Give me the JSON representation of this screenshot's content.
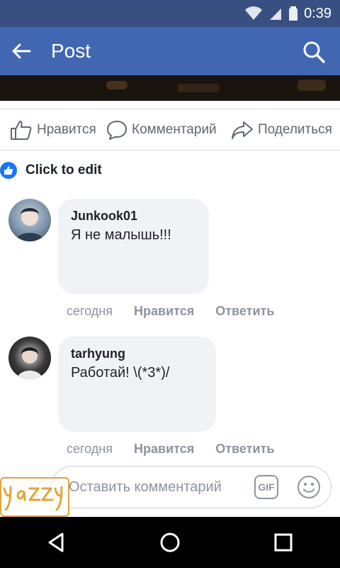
{
  "status_bar": {
    "time": "0:39"
  },
  "app_bar": {
    "title": "Post"
  },
  "actions": {
    "like_label": "Нравится",
    "comment_label": "Комментарий",
    "share_label": "Поделиться"
  },
  "reactions": {
    "label": "Click to edit"
  },
  "comments": [
    {
      "author": "Junkook01",
      "text": "Я не малышь!!!",
      "time": "сегодня",
      "like": "Нравится",
      "reply": "Ответить"
    },
    {
      "author": "tarhyung",
      "text": "Работай! \\(*3*)/",
      "time": "сегодня",
      "like": "Нравится",
      "reply": "Ответить"
    }
  ],
  "composer": {
    "placeholder": "Оставить комментарий",
    "gif_label": "GIF"
  },
  "watermark": {
    "text": "yazzy"
  },
  "colors": {
    "brand": "#4267b2",
    "status": "#384f82",
    "bubble": "#f0f2f5",
    "meta_text": "#8d949e"
  },
  "icons": [
    "signal-icon",
    "wifi-icon",
    "battery-icon",
    "back-arrow-icon",
    "search-icon",
    "like-icon",
    "comment-icon",
    "share-icon",
    "gif-icon",
    "emoji-icon",
    "nav-back-icon",
    "nav-home-icon",
    "nav-recents-icon"
  ]
}
